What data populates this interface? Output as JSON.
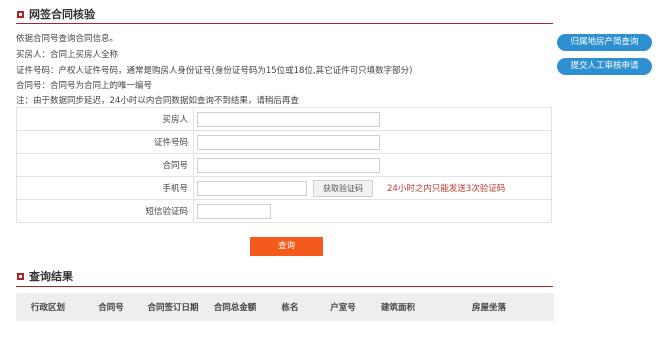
{
  "check_section": {
    "title": "网签合同核验",
    "info_lines": [
      "依据合同号查询合同信息。",
      "买房人：合同上买房人全称",
      "证件号码：产权人证件号码，通常是购房人身份证号(身份证号码为15位或18位,其它证件可只填数字部分)",
      "合同号：合同号为合同上的唯一编号",
      "注：由于数据同步延迟，24小时以内合同数据如查询不到结果，请稍后再查"
    ]
  },
  "form": {
    "buyer_label": "买房人",
    "id_label": "证件号码",
    "contract_label": "合同号",
    "phone_label": "手机号",
    "get_code_button": "获取验证码",
    "code_tip": "24小时之内只能发送3次验证码",
    "sms_label": "短信验证码",
    "buyer_value": "",
    "id_value": "",
    "contract_value": "",
    "phone_value": "",
    "sms_value": ""
  },
  "query_button": "查询",
  "side_buttons": {
    "property_query": "归属地房产简查询",
    "manual_review": "提交人工审核申请"
  },
  "result_section": {
    "title": "查询结果",
    "columns": [
      "行政区划",
      "合同号",
      "合同签订日期",
      "合同总金额",
      "栋名",
      "户室号",
      "建筑面积",
      "房屋坐落"
    ]
  },
  "colors": {
    "accent_red": "#b22222",
    "button_orange": "#f45a1c",
    "side_blue": "#2e8fd1",
    "tip_red": "#c0392b"
  },
  "icons": {
    "section_icon": "section-marker-icon"
  }
}
